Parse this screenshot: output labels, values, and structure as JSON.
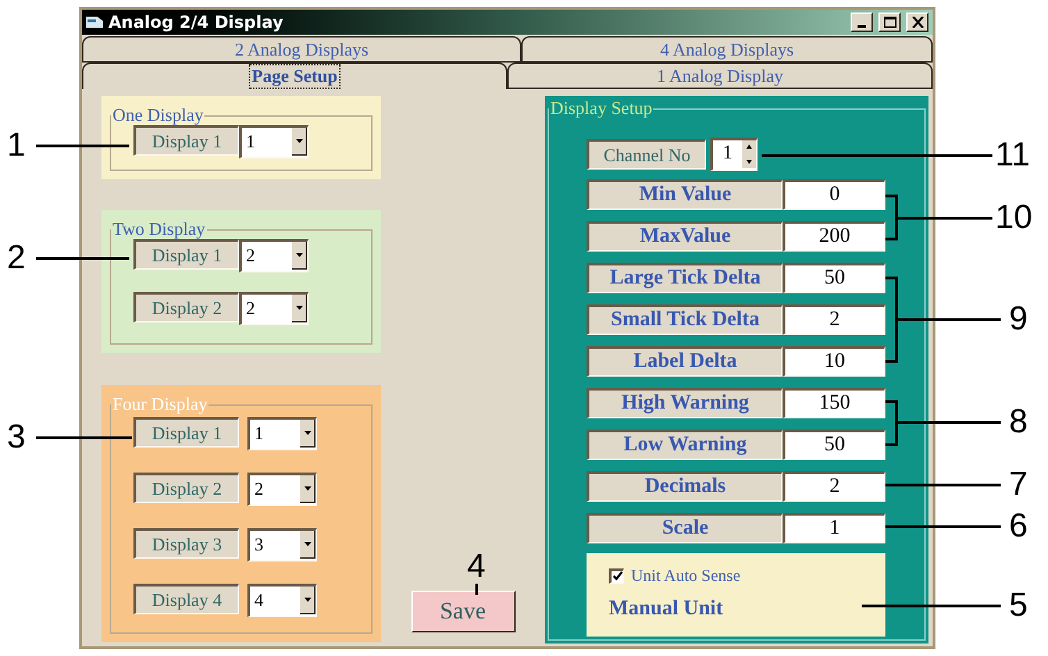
{
  "window": {
    "title": "Analog 2/4 Display"
  },
  "tabs": [
    {
      "label": "2 Analog Displays",
      "selected": false
    },
    {
      "label": "4 Analog Displays",
      "selected": false
    },
    {
      "label": "Page Setup",
      "selected": true
    },
    {
      "label": "1 Analog Display",
      "selected": false
    }
  ],
  "groups": [
    {
      "title": "One  Display",
      "color": "#f8f0c8",
      "rows": [
        {
          "label": "Display 1",
          "value": "1"
        }
      ]
    },
    {
      "title": "Two  Display",
      "color": "#d8ecc8",
      "rows": [
        {
          "label": "Display 1",
          "value": "2"
        },
        {
          "label": "Display 2",
          "value": "2"
        }
      ]
    },
    {
      "title": "Four Display",
      "color": "#f8c488",
      "rows": [
        {
          "label": "Display 1",
          "value": "1"
        },
        {
          "label": "Display 2",
          "value": "2"
        },
        {
          "label": "Display 3",
          "value": "3"
        },
        {
          "label": "Display 4",
          "value": "4"
        }
      ]
    }
  ],
  "save_button": "Save",
  "display_setup": {
    "title": "Display  Setup",
    "channel": {
      "label": "Channel No",
      "value": "1"
    },
    "fields": [
      {
        "label": "Min Value",
        "value": "0"
      },
      {
        "label": "MaxValue",
        "value": "200"
      },
      {
        "label": "Large Tick Delta",
        "value": "50"
      },
      {
        "label": "Small Tick Delta",
        "value": "2"
      },
      {
        "label": "Label Delta",
        "value": "10"
      },
      {
        "label": "High Warning",
        "value": "150"
      },
      {
        "label": "Low Warning",
        "value": "50"
      },
      {
        "label": "Decimals",
        "value": "2"
      },
      {
        "label": "Scale",
        "value": "1"
      }
    ],
    "unit_auto_sense": {
      "label": "Unit Auto Sense",
      "checked": true
    },
    "manual_unit": "Manual Unit"
  },
  "callouts": [
    {
      "label": "1"
    },
    {
      "label": "11"
    },
    {
      "label": "10"
    },
    {
      "label": "2"
    },
    {
      "label": "9"
    },
    {
      "label": "8"
    },
    {
      "label": "3"
    },
    {
      "label": "7"
    },
    {
      "label": "6"
    },
    {
      "label": "4"
    },
    {
      "label": "5"
    }
  ]
}
